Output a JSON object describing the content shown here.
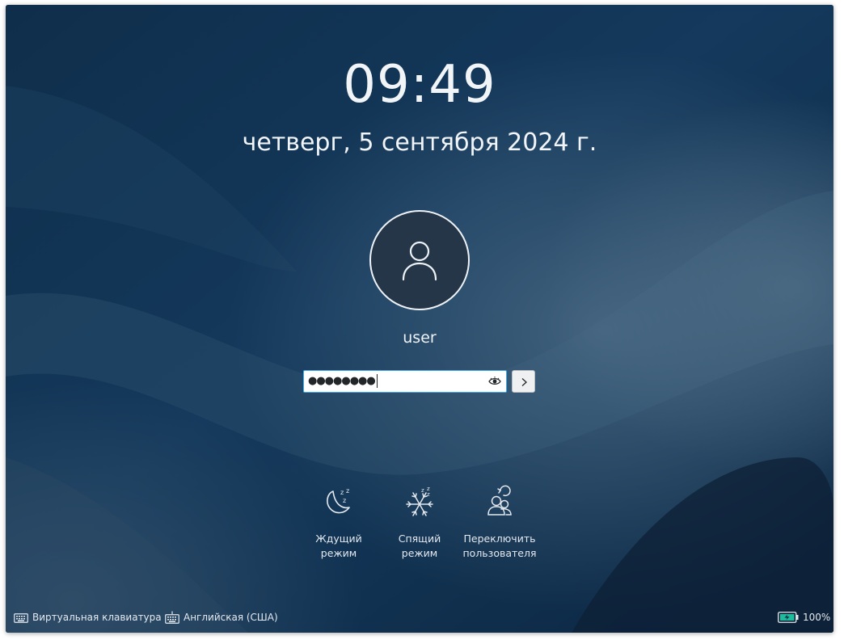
{
  "clock": {
    "time": "09:49",
    "date": "четверг, 5 сентября 2024 г."
  },
  "user": {
    "name": "user"
  },
  "password": {
    "masked_value": "●●●●●●●●"
  },
  "actions": [
    {
      "label": "Ждущий\nрежим",
      "icon": "moon-sleep-icon"
    },
    {
      "label": "Спящий\nрежим",
      "icon": "snowflake-hibernate-icon"
    },
    {
      "label": "Переключить\nпользователя",
      "icon": "switch-user-icon"
    }
  ],
  "footer": {
    "virtual_keyboard": "Виртуальная клавиатура",
    "keyboard_layout": "Английская (США)",
    "battery": "100%"
  },
  "colors": {
    "background": "#103150",
    "field_focus_border": "#3daee9",
    "battery_fill": "#1ebc9c"
  }
}
